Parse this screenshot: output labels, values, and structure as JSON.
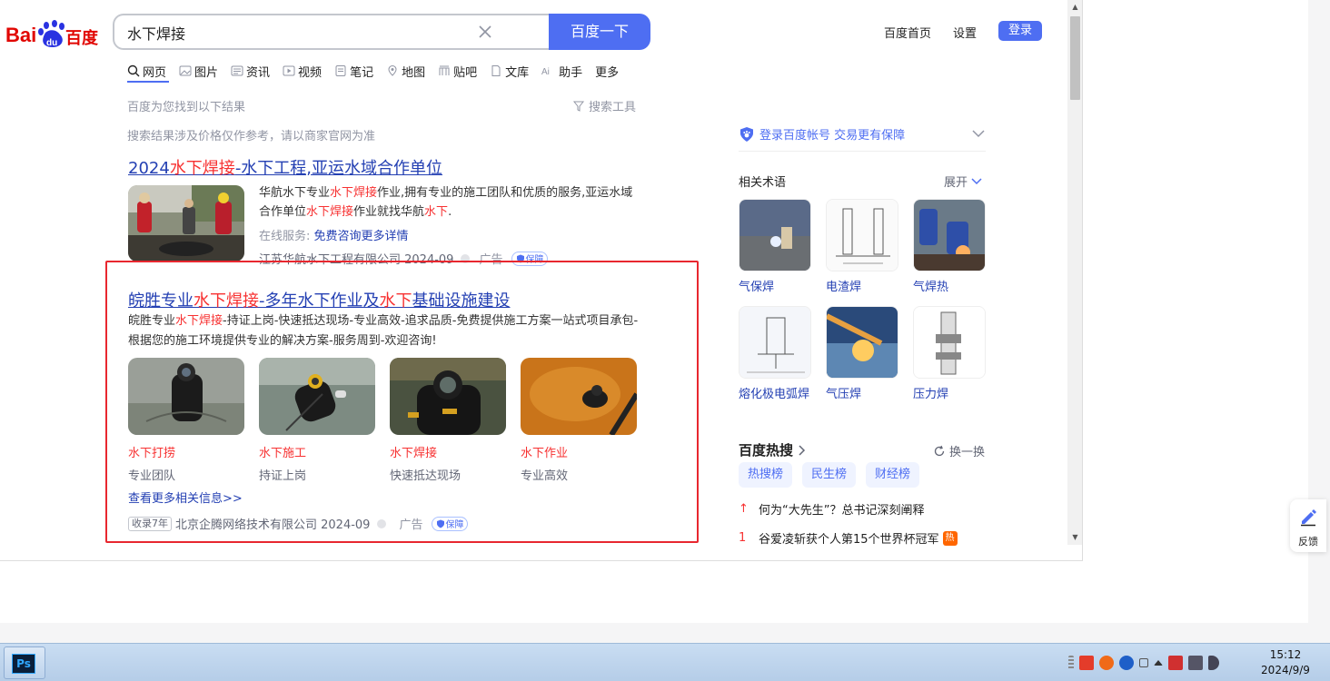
{
  "header": {
    "logo_text": "Bai百度",
    "search_value": "水下焊接",
    "search_button": "百度一下",
    "links": [
      "百度首页",
      "设置"
    ],
    "login": "登录"
  },
  "tabs": [
    {
      "label": "网页",
      "icon": "search-icon"
    },
    {
      "label": "图片",
      "icon": "image-icon"
    },
    {
      "label": "资讯",
      "icon": "news-icon"
    },
    {
      "label": "视频",
      "icon": "video-icon"
    },
    {
      "label": "笔记",
      "icon": "note-icon"
    },
    {
      "label": "地图",
      "icon": "map-icon"
    },
    {
      "label": "贴吧",
      "icon": "tieba-icon"
    },
    {
      "label": "文库",
      "icon": "doc-icon"
    },
    {
      "label": "助手",
      "icon": "ai-icon"
    },
    {
      "label": "更多",
      "icon": ""
    }
  ],
  "found_text": "百度为您找到以下结果",
  "tools_label": "搜索工具",
  "notice": "搜索结果涉及价格仅作参考，请以商家官网为准",
  "result1": {
    "title_parts": [
      "2024",
      "水下焊接",
      "-水下工程,亚运水域合作单位"
    ],
    "desc_parts": [
      "华航水下专业",
      "水下焊接",
      "作业,拥有专业的施工团队和优质的服务,亚运水域合作单位",
      "水下焊接",
      "作业就找华航",
      "水下",
      "."
    ],
    "online_label": "在线服务:",
    "online_link": "免费咨询更多详情",
    "company": "江苏华航水下工程有限公司 2024-09",
    "ad": "广告",
    "badge": "保障"
  },
  "result2": {
    "title_parts": [
      "皖胜专业",
      "水下焊接",
      "-多年水下作业及",
      "水下",
      "基础设施建设"
    ],
    "desc_parts": [
      "皖胜专业",
      "水下焊接",
      "-持证上岗-快速抵达现场-专业高效-追求品质-免费提供施工方案一站式项目承包-根据您的施工环境提供专业的解决方案-服务周到-欢迎咨询!"
    ],
    "cards": [
      {
        "title": "水下打捞",
        "sub": "专业团队"
      },
      {
        "title": "水下施工",
        "sub": "持证上岗"
      },
      {
        "title": "水下焊接",
        "sub": "快速抵达现场"
      },
      {
        "title": "水下作业",
        "sub": "专业高效"
      }
    ],
    "more": "查看更多相关信息>>",
    "shoulu": "收录7年",
    "company": "北京企腾网络技术有限公司 2024-09",
    "ad": "广告",
    "badge": "保障"
  },
  "right": {
    "login_tip": "登录百度帐号 交易更有保障",
    "terms_title": "相关术语",
    "expand": "展开",
    "terms": [
      "气保焊",
      "电渣焊",
      "气焊热",
      "熔化极电弧焊",
      "气压焊",
      "压力焊"
    ],
    "hot_title": "百度热搜",
    "refresh": "换一换",
    "hot_tabs": [
      "热搜榜",
      "民生榜",
      "财经榜"
    ],
    "hot_items": [
      {
        "rank": "↑",
        "text": "何为“大先生”？总书记深刻阐释",
        "tag": ""
      },
      {
        "rank": "1",
        "text": "谷爱凌斩获个人第15个世界杯冠军",
        "tag": "热"
      }
    ]
  },
  "feedback": "反馈",
  "taskbar": {
    "app": "Ps",
    "time": "15:12",
    "date": "2024/9/9"
  }
}
